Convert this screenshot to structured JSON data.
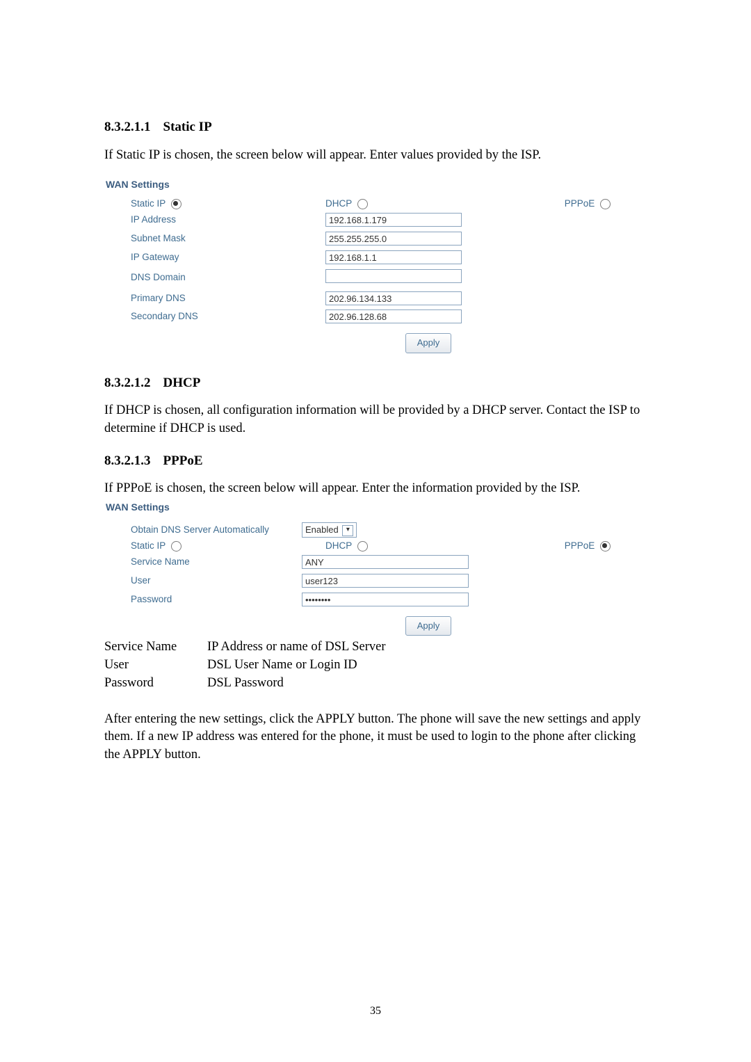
{
  "sections": {
    "static_ip": {
      "heading_no": "8.3.2.1.1",
      "heading_title": "Static IP",
      "intro": "If Static IP is chosen, the screen below will appear.    Enter values provided by the ISP."
    },
    "dhcp": {
      "heading_no": "8.3.2.1.2",
      "heading_title": "DHCP",
      "body": "If DHCP is chosen, all configuration information will be provided by a DHCP server. Contact the ISP to determine if DHCP is used."
    },
    "pppoe": {
      "heading_no": "8.3.2.1.3",
      "heading_title": "PPPoE",
      "intro": "If PPPoE is chosen, the screen below will appear.    Enter the information provided by the ISP.",
      "definitions": {
        "service_name_k": "Service Name",
        "service_name_v": "IP Address or name of DSL Server",
        "user_k": "User",
        "user_v": "DSL User Name or Login ID",
        "password_k": "Password",
        "password_v": "DSL Password"
      },
      "closing": "After entering the new settings, click the APPLY button.    The phone will save the new settings and apply them.    If a new IP address was entered for the phone, it must be used to login to the phone after clicking the APPLY button."
    }
  },
  "form_static": {
    "title": "WAN Settings",
    "radios": {
      "static_ip_label": "Static IP",
      "dhcp_label": "DHCP",
      "pppoe_label": "PPPoE",
      "selected": "static_ip"
    },
    "fields": {
      "ip_address_label": "IP Address",
      "ip_address_value": "192.168.1.179",
      "subnet_mask_label": "Subnet Mask",
      "subnet_mask_value": "255.255.255.0",
      "ip_gateway_label": "IP Gateway",
      "ip_gateway_value": "192.168.1.1",
      "dns_domain_label": "DNS Domain",
      "dns_domain_value": "",
      "primary_dns_label": "Primary DNS",
      "primary_dns_value": "202.96.134.133",
      "secondary_dns_label": "Secondary DNS",
      "secondary_dns_value": "202.96.128.68"
    },
    "apply_label": "Apply"
  },
  "form_pppoe": {
    "title": "WAN Settings",
    "obtain_dns_label": "Obtain DNS Server Automatically",
    "obtain_dns_value": "Enabled",
    "radios": {
      "static_ip_label": "Static IP",
      "dhcp_label": "DHCP",
      "pppoe_label": "PPPoE",
      "selected": "pppoe"
    },
    "fields": {
      "service_name_label": "Service Name",
      "service_name_value": "ANY",
      "user_label": "User",
      "user_value": "user123",
      "password_label": "Password",
      "password_value": "••••••••"
    },
    "apply_label": "Apply"
  },
  "page_number": "35"
}
